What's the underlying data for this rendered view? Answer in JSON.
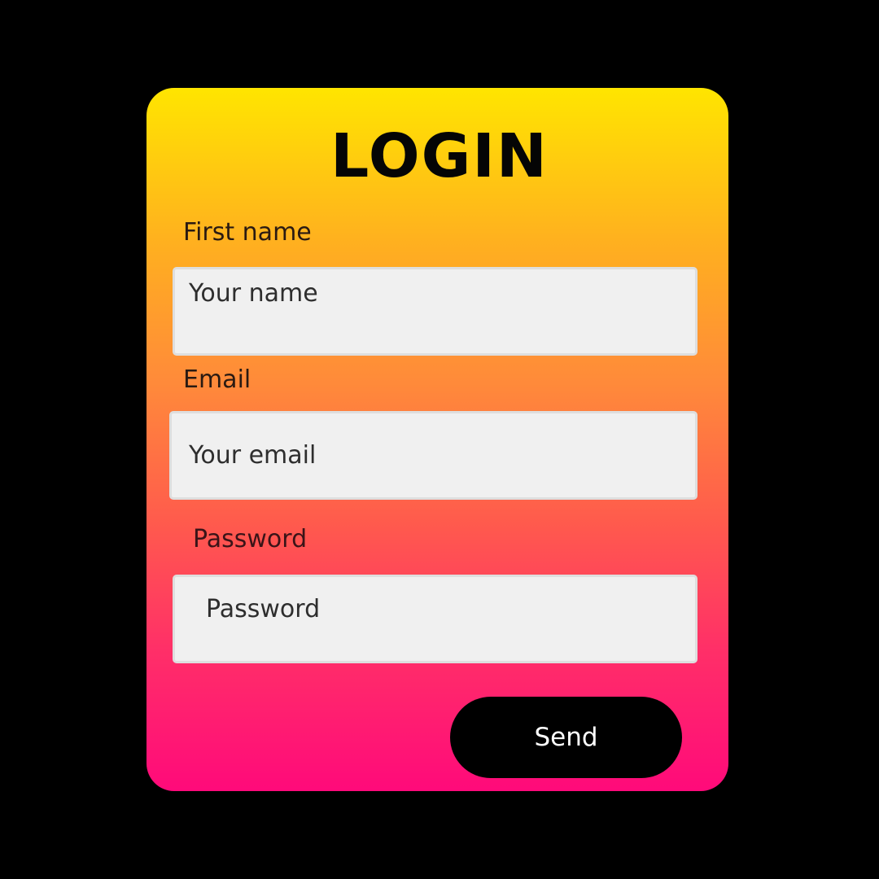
{
  "login_form": {
    "title": "LOGIN",
    "first_name": {
      "label": "First name",
      "placeholder": "Your name",
      "value": ""
    },
    "email": {
      "label": "Email",
      "placeholder": "Your email",
      "value": ""
    },
    "password": {
      "label": "Password",
      "placeholder": "Password",
      "value": ""
    },
    "submit_label": "Send"
  },
  "colors": {
    "background": "#000000",
    "gradient_top": "#ffe500",
    "gradient_bottom": "#ff0a7a",
    "field_background": "#f0f0f0",
    "button_background": "#000000",
    "button_text": "#ffffff"
  }
}
